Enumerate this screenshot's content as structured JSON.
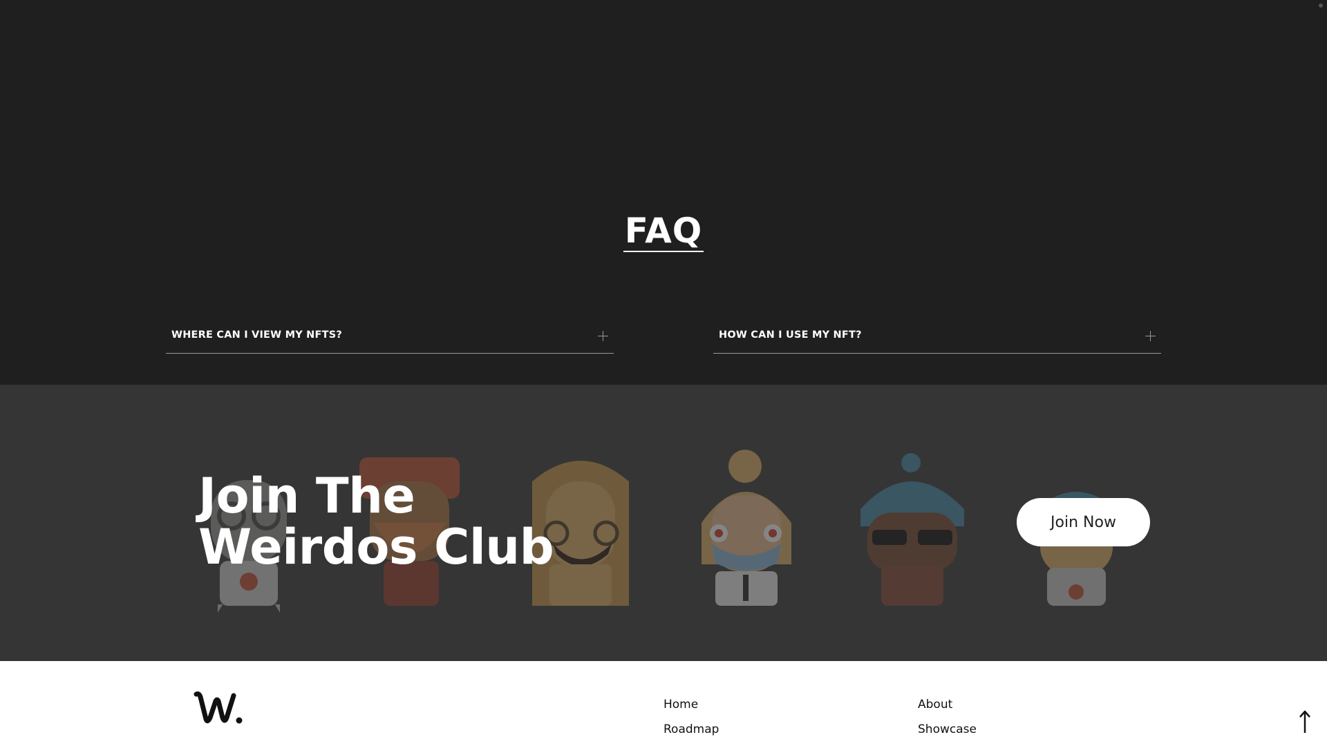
{
  "faq": {
    "title": "FAQ",
    "items": [
      {
        "question": "WHERE CAN I VIEW MY NFTS?",
        "icon": "plus-icon"
      },
      {
        "question": "HOW CAN I USE MY NFT?",
        "icon": "plus-icon"
      }
    ]
  },
  "join": {
    "title_line1": "Join The",
    "title_line2": "Weirdos Club",
    "button_label": "Join Now"
  },
  "footer": {
    "logo_icon": "weirdos-logo-icon",
    "links_col1": [
      "Home",
      "Roadmap"
    ],
    "links_col2": [
      "About",
      "Showcase"
    ],
    "scroll_top_icon": "arrow-up-icon"
  },
  "colors": {
    "faq_bg": "#1f1f20",
    "join_bg": "#353535",
    "footer_bg": "#ffffff",
    "accent_white": "#ffffff"
  }
}
